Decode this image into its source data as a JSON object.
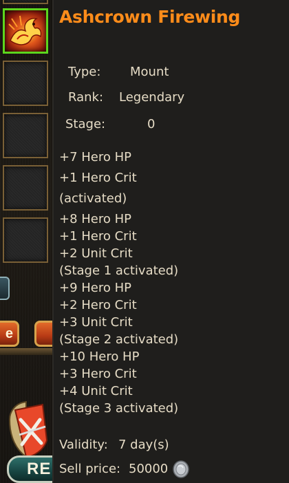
{
  "item": {
    "name": "Ashcrown Firewing",
    "type_label": "Type:",
    "type_value": "Mount",
    "rank_label": "Rank:",
    "rank_value": "Legendary",
    "stage_label": "Stage:",
    "stage_value": "0"
  },
  "stats": [
    "+7 Hero HP",
    "+1 Hero Crit",
    "(activated)",
    "+8 Hero HP",
    "+1 Hero Crit",
    "+2 Unit Crit",
    "(Stage 1 activated)",
    "+9 Hero HP",
    "+2 Hero Crit",
    "+3 Unit Crit",
    "(Stage 2 activated)",
    "+10 Hero HP",
    "+3 Hero Crit",
    "+4 Unit Crit",
    "(Stage 3 activated)"
  ],
  "footer": {
    "validity_label": "Validity:",
    "validity_value": "7 day(s)",
    "sell_label": "Sell price:",
    "sell_value": "50000"
  },
  "left_panel": {
    "tab_a_label": "e",
    "banner_label": "RE"
  },
  "colors": {
    "title": "#ff8c1a",
    "text": "#e6dcc6",
    "selected_border": "#5cd61e",
    "slot_border": "#7a6036",
    "panel_bg": "#1f1e1c"
  },
  "icons": {
    "selected_slot": "fire-dragon-icon",
    "coin": "silver-coin-icon",
    "emblem": "sword-shield-emblem-icon"
  }
}
